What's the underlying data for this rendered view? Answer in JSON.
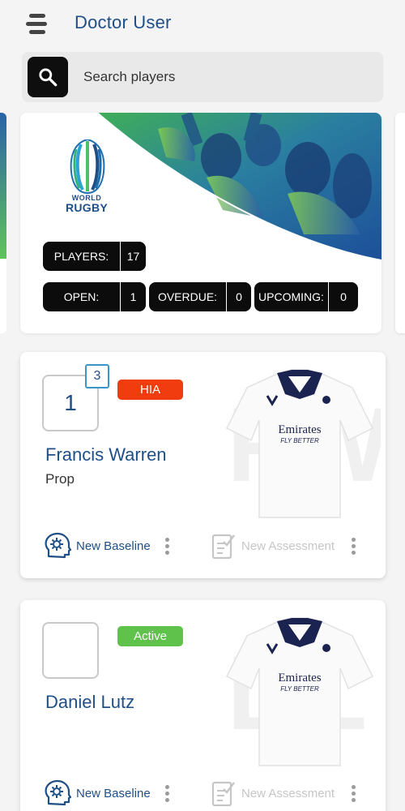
{
  "header": {
    "title": "Doctor User",
    "menu_icon": "hamburger-menu-icon"
  },
  "search": {
    "placeholder": "Search players",
    "icon": "search-icon"
  },
  "team": {
    "logo_line1": "WORLD",
    "logo_line2": "RUGBY",
    "players_label": "PLAYERS:",
    "players_count": "17",
    "open_label": "OPEN:",
    "open_count": "1",
    "overdue_label": "OVERDUE:",
    "overdue_count": "0",
    "upcoming_label": "UPCOMING:",
    "upcoming_count": "0"
  },
  "players": [
    {
      "number": "1",
      "badge": "3",
      "status": "HIA",
      "status_color": "#f03c0f",
      "name": "Francis Warren",
      "position": "Prop",
      "baseline_label": "New Baseline",
      "assessment_label": "New Assessment",
      "jersey_sponsor": "Emirates",
      "jersey_sponsor_sub": "FLY BETTER"
    },
    {
      "number": "",
      "status": "Active",
      "status_color": "#5fc24b",
      "name": "Daniel Lutz",
      "position": "",
      "baseline_label": "New Baseline",
      "assessment_label": "New Assessment",
      "jersey_sponsor": "Emirates",
      "jersey_sponsor_sub": "FLY BETTER"
    }
  ],
  "colors": {
    "brand_blue": "#1f4f87",
    "green": "#5fc24b",
    "hia_red": "#f03c0f"
  }
}
